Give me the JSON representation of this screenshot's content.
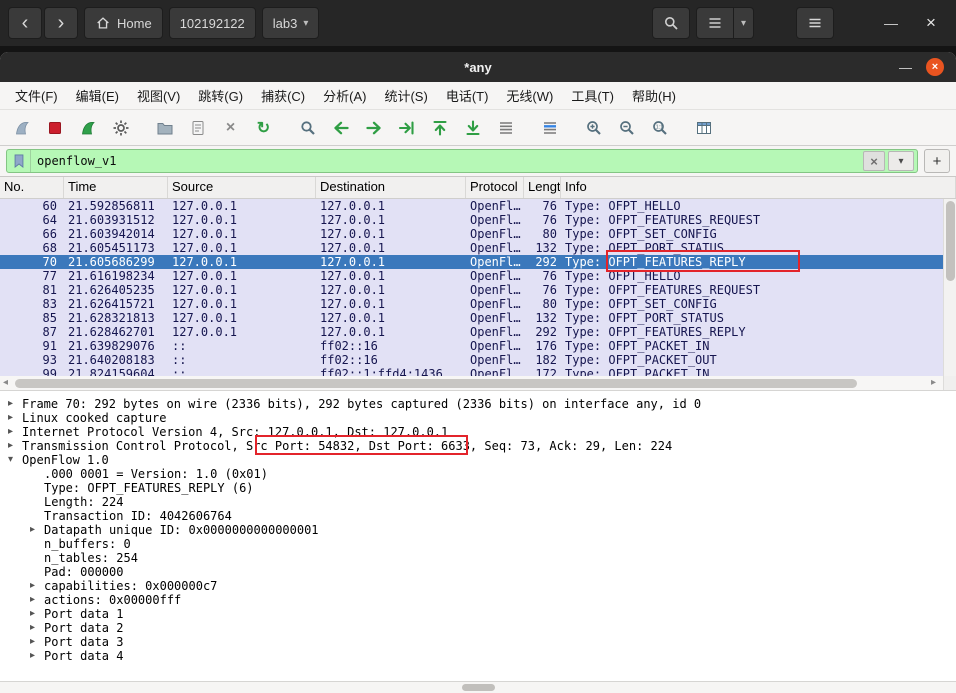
{
  "topbar": {
    "back_icon": "‹",
    "forward_icon": "›",
    "tabs": [
      {
        "label": "Home"
      },
      {
        "label": "102192122"
      },
      {
        "label": "lab3",
        "caret": "▾"
      }
    ],
    "view_caret": "▾",
    "minimize_glyph": "—",
    "close_glyph": "×"
  },
  "wireshark": {
    "title": "*any",
    "titlebar": {
      "minimize_glyph": "—",
      "close_glyph": "×"
    },
    "menu": [
      "文件(F)",
      "编辑(E)",
      "视图(V)",
      "跳转(G)",
      "捕获(C)",
      "分析(A)",
      "统计(S)",
      "电话(T)",
      "无线(W)",
      "工具(T)",
      "帮助(H)"
    ],
    "filter": {
      "value": "openflow_v1",
      "clear_glyph": "×",
      "apply_glyph": "▾",
      "add_glyph": "+"
    },
    "packet_list": {
      "columns": [
        "No.",
        "Time",
        "Source",
        "Destination",
        "Protocol",
        "Length",
        "Info"
      ],
      "selected_index": 4,
      "rows": [
        {
          "no": "60",
          "time": "21.592856811",
          "src": "127.0.0.1",
          "dst": "127.0.0.1",
          "proto": "OpenFl…",
          "len": "76",
          "info": "Type: OFPT_HELLO"
        },
        {
          "no": "64",
          "time": "21.603931512",
          "src": "127.0.0.1",
          "dst": "127.0.0.1",
          "proto": "OpenFl…",
          "len": "76",
          "info": "Type: OFPT_FEATURES_REQUEST"
        },
        {
          "no": "66",
          "time": "21.603942014",
          "src": "127.0.0.1",
          "dst": "127.0.0.1",
          "proto": "OpenFl…",
          "len": "80",
          "info": "Type: OFPT_SET_CONFIG"
        },
        {
          "no": "68",
          "time": "21.605451173",
          "src": "127.0.0.1",
          "dst": "127.0.0.1",
          "proto": "OpenFl…",
          "len": "132",
          "info": "Type: OFPT_PORT_STATUS"
        },
        {
          "no": "70",
          "time": "21.605686299",
          "src": "127.0.0.1",
          "dst": "127.0.0.1",
          "proto": "OpenFl…",
          "len": "292",
          "info": "Type: OFPT_FEATURES_REPLY"
        },
        {
          "no": "77",
          "time": "21.616198234",
          "src": "127.0.0.1",
          "dst": "127.0.0.1",
          "proto": "OpenFl…",
          "len": "76",
          "info": "Type: OFPT_HELLO"
        },
        {
          "no": "81",
          "time": "21.626405235",
          "src": "127.0.0.1",
          "dst": "127.0.0.1",
          "proto": "OpenFl…",
          "len": "76",
          "info": "Type: OFPT_FEATURES_REQUEST"
        },
        {
          "no": "83",
          "time": "21.626415721",
          "src": "127.0.0.1",
          "dst": "127.0.0.1",
          "proto": "OpenFl…",
          "len": "80",
          "info": "Type: OFPT_SET_CONFIG"
        },
        {
          "no": "85",
          "time": "21.628321813",
          "src": "127.0.0.1",
          "dst": "127.0.0.1",
          "proto": "OpenFl…",
          "len": "132",
          "info": "Type: OFPT_PORT_STATUS"
        },
        {
          "no": "87",
          "time": "21.628462701",
          "src": "127.0.0.1",
          "dst": "127.0.0.1",
          "proto": "OpenFl…",
          "len": "292",
          "info": "Type: OFPT_FEATURES_REPLY"
        },
        {
          "no": "91",
          "time": "21.639829076",
          "src": "::",
          "dst": "ff02::16",
          "proto": "OpenFl…",
          "len": "176",
          "info": "Type: OFPT_PACKET_IN"
        },
        {
          "no": "93",
          "time": "21.640208183",
          "src": "::",
          "dst": "ff02::16",
          "proto": "OpenFl…",
          "len": "182",
          "info": "Type: OFPT_PACKET_OUT"
        },
        {
          "no": "99",
          "time": "21.824159604",
          "src": "::",
          "dst": "ff02::1:ffd4:1436",
          "proto": "OpenFl…",
          "len": "172",
          "info": "Type: OFPT_PACKET_IN"
        }
      ]
    },
    "details": [
      {
        "arrow": "▸",
        "level": 0,
        "text": "Frame 70: 292 bytes on wire (2336 bits), 292 bytes captured (2336 bits) on interface any, id 0"
      },
      {
        "arrow": "▸",
        "level": 0,
        "text": "Linux cooked capture"
      },
      {
        "arrow": "▸",
        "level": 0,
        "text": "Internet Protocol Version 4, Src: 127.0.0.1, Dst: 127.0.0.1"
      },
      {
        "arrow": "▸",
        "level": 0,
        "text": "Transmission Control Protocol, Src Port: 54832, Dst Port: 6633, Seq: 73, Ack: 29, Len: 224"
      },
      {
        "arrow": "▾",
        "level": 0,
        "text": "OpenFlow 1.0"
      },
      {
        "arrow": "",
        "level": 1,
        "text": ".000 0001 = Version: 1.0 (0x01)"
      },
      {
        "arrow": "",
        "level": 1,
        "text": "Type: OFPT_FEATURES_REPLY (6)"
      },
      {
        "arrow": "",
        "level": 1,
        "text": "Length: 224"
      },
      {
        "arrow": "",
        "level": 1,
        "text": "Transaction ID: 4042606764"
      },
      {
        "arrow": "▸",
        "level": 1,
        "text": "Datapath unique ID: 0x0000000000000001"
      },
      {
        "arrow": "",
        "level": 1,
        "text": "n_buffers: 0"
      },
      {
        "arrow": "",
        "level": 1,
        "text": "n_tables: 254"
      },
      {
        "arrow": "",
        "level": 1,
        "text": "Pad: 000000"
      },
      {
        "arrow": "▸",
        "level": 1,
        "text": "capabilities: 0x000000c7"
      },
      {
        "arrow": "▸",
        "level": 1,
        "text": "actions: 0x00000fff"
      },
      {
        "arrow": "▸",
        "level": 1,
        "text": "Port data 1"
      },
      {
        "arrow": "▸",
        "level": 1,
        "text": "Port data 2"
      },
      {
        "arrow": "▸",
        "level": 1,
        "text": "Port data 3"
      },
      {
        "arrow": "▸",
        "level": 1,
        "text": "Port data 4"
      }
    ],
    "colors": {
      "row_bg": "#e2e1f5",
      "selected_bg": "#3b78bc",
      "filter_bg": "#b6f8b6",
      "annotation": "#e3242b",
      "close_button": "#e95420"
    }
  }
}
